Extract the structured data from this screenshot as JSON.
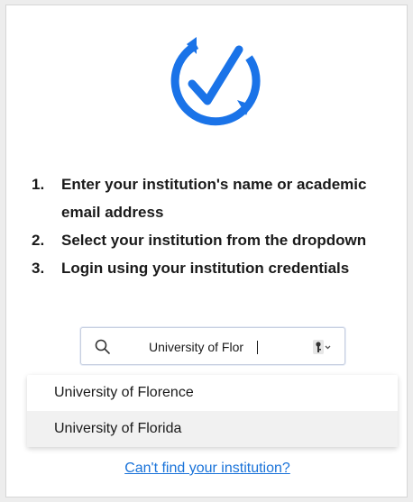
{
  "colors": {
    "accent": "#1a73e8",
    "link": "#1a73d9",
    "highlight": "#f1f1f1"
  },
  "logo": {
    "icon": "check-circle-icon"
  },
  "steps": [
    {
      "num": "1.",
      "text": "Enter your institution's name or academic email address"
    },
    {
      "num": "2.",
      "text": "Select your institution from the dropdown"
    },
    {
      "num": "3.",
      "text": "Login using your institution credentials"
    }
  ],
  "search": {
    "icon": "search-icon",
    "value": "University of Flor",
    "right_icon": "key-dropdown-icon"
  },
  "dropdown": {
    "options": [
      {
        "label": "University of Florence",
        "highlighted": false
      },
      {
        "label": "University of Florida",
        "highlighted": true
      }
    ]
  },
  "help_link": "Can't find your institution?"
}
